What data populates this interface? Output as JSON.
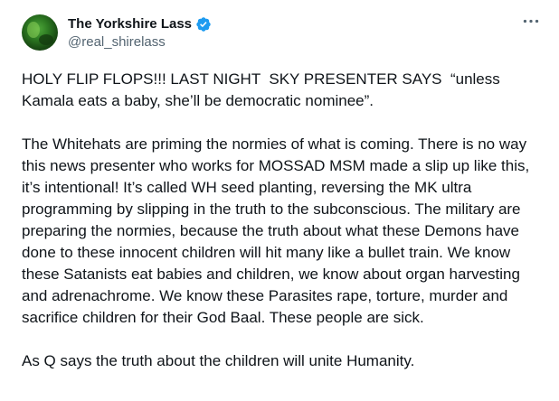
{
  "author": {
    "display_name": "The Yorkshire Lass",
    "handle": "@real_shirelass",
    "verified_badge_icon": "verified-badge-icon",
    "verified_color": "#1d9bf0",
    "avatar_icon": "avatar-image"
  },
  "menu": {
    "icon": "more-options-icon"
  },
  "tweet": {
    "paragraphs": [
      "HOLY FLIP FLOPS!!! LAST NIGHT  SKY PRESENTER SAYS  “unless Kamala eats a baby, she’ll be democratic nominee”.",
      "The Whitehats are priming the normies of what is coming. There is no way this news presenter who works for MOSSAD MSM made a slip up like this, it’s intentional! It’s called WH seed planting, reversing the MK ultra programming by slipping in the truth to the subconscious. The military are preparing the normies, because the truth about what these Demons have done to these innocent children will hit many like a bullet train. We know these Satanists eat babies and children, we know about organ harvesting and adrenachrome. We know these Parasites rape, torture, murder and sacrifice children for their God Baal. These people are sick.",
      "As Q says the truth about the children will unite Humanity."
    ]
  }
}
